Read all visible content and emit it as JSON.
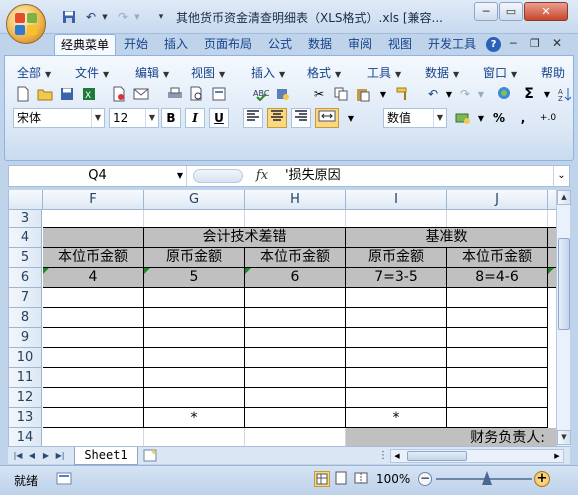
{
  "window": {
    "title": "其他货币资金清查明细表（XLS格式）.xls  [兼容..."
  },
  "ribbon_tabs": [
    {
      "label": "经典菜单"
    },
    {
      "label": "开始"
    },
    {
      "label": "插入"
    },
    {
      "label": "页面布局"
    },
    {
      "label": "公式"
    },
    {
      "label": "数据"
    },
    {
      "label": "审阅"
    },
    {
      "label": "视图"
    },
    {
      "label": "开发工具"
    }
  ],
  "classic_menu": [
    {
      "label": "全部"
    },
    {
      "label": "文件"
    },
    {
      "label": "编辑"
    },
    {
      "label": "视图"
    },
    {
      "label": "插入"
    },
    {
      "label": "格式"
    },
    {
      "label": "工具"
    },
    {
      "label": "数据"
    },
    {
      "label": "窗口"
    },
    {
      "label": "帮助"
    }
  ],
  "format_bar": {
    "font_name": "宋体",
    "font_size": "12",
    "bold": "B",
    "italic": "I",
    "underline": "U",
    "number_format": "数值",
    "percent": "%",
    "comma": ",",
    "decimal": "+.0"
  },
  "formula_bar": {
    "name_box": "Q4",
    "fx": "fx",
    "formula": "'损失原因"
  },
  "columns": [
    "F",
    "G",
    "H",
    "I",
    "J"
  ],
  "rows": [
    "3",
    "4",
    "5",
    "6",
    "7",
    "8",
    "9",
    "10",
    "11",
    "12",
    "13",
    "14"
  ],
  "cells": {
    "r4_group_accounting": "会计技术差错",
    "r4_group_benchmark": "基准数",
    "r5": [
      "本位币金额",
      "原币金额",
      "本位币金额",
      "原币金额",
      "本位币金额"
    ],
    "r6": [
      "4",
      "5",
      "6",
      "7=3-5",
      "8=4-6"
    ],
    "r13_g": "*",
    "r13_i": "*",
    "r14_signature": "财务负责人:"
  },
  "sheet_tabs": [
    {
      "label": "Sheet1"
    }
  ],
  "status_bar": {
    "mode": "就绪",
    "zoom": "100%"
  },
  "colors": {
    "header_gray": "#c0c0c0",
    "ribbon_text": "#15428b"
  }
}
